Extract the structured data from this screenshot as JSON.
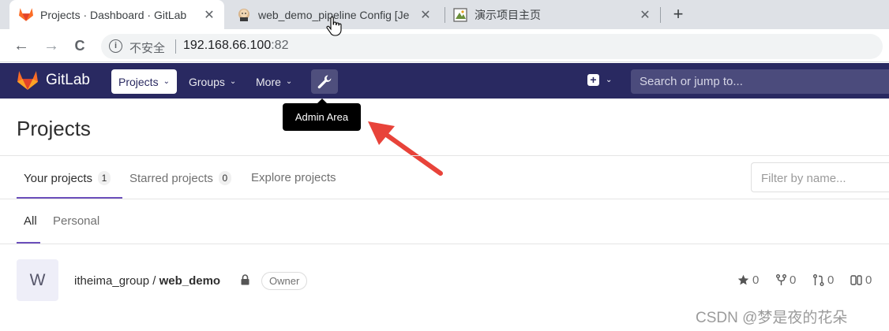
{
  "browser": {
    "tabs": [
      {
        "title": "Projects · Dashboard · GitLab",
        "close": "✕"
      },
      {
        "title": "web_demo_pipeline Config [Je",
        "close": "✕"
      },
      {
        "title": "演示项目主页",
        "close": "✕"
      }
    ],
    "new_tab": "+",
    "nav": {
      "back": "←",
      "forward": "→",
      "reload": "C"
    },
    "address": {
      "info_glyph": "i",
      "security_label": "不安全",
      "host": "192.168.66.100",
      "port": ":82"
    }
  },
  "header": {
    "brand": "GitLab",
    "nav": [
      {
        "label": "Projects"
      },
      {
        "label": "Groups"
      },
      {
        "label": "More"
      }
    ],
    "chevron": "⌄",
    "plus_glyph": "+",
    "search_placeholder": "Search or jump to..."
  },
  "tooltip": {
    "text": "Admin Area"
  },
  "page": {
    "title": "Projects",
    "tabs": [
      {
        "label": "Your projects",
        "count": "1"
      },
      {
        "label": "Starred projects",
        "count": "0"
      },
      {
        "label": "Explore projects"
      }
    ],
    "filter_placeholder": "Filter by name...",
    "subtabs": [
      {
        "label": "All"
      },
      {
        "label": "Personal"
      }
    ],
    "project": {
      "avatar_letter": "W",
      "namespace": "itheima_group / ",
      "name": "web_demo",
      "role": "Owner",
      "stars": "0",
      "forks": "0",
      "merge_requests": "0",
      "issues": "0"
    }
  },
  "watermark": "CSDN @梦是夜的花朵",
  "colors": {
    "header_bg": "#292961",
    "accent": "#6b4fbb",
    "arrow": "#e8433a",
    "gitlab_orange": "#fc6d26"
  }
}
